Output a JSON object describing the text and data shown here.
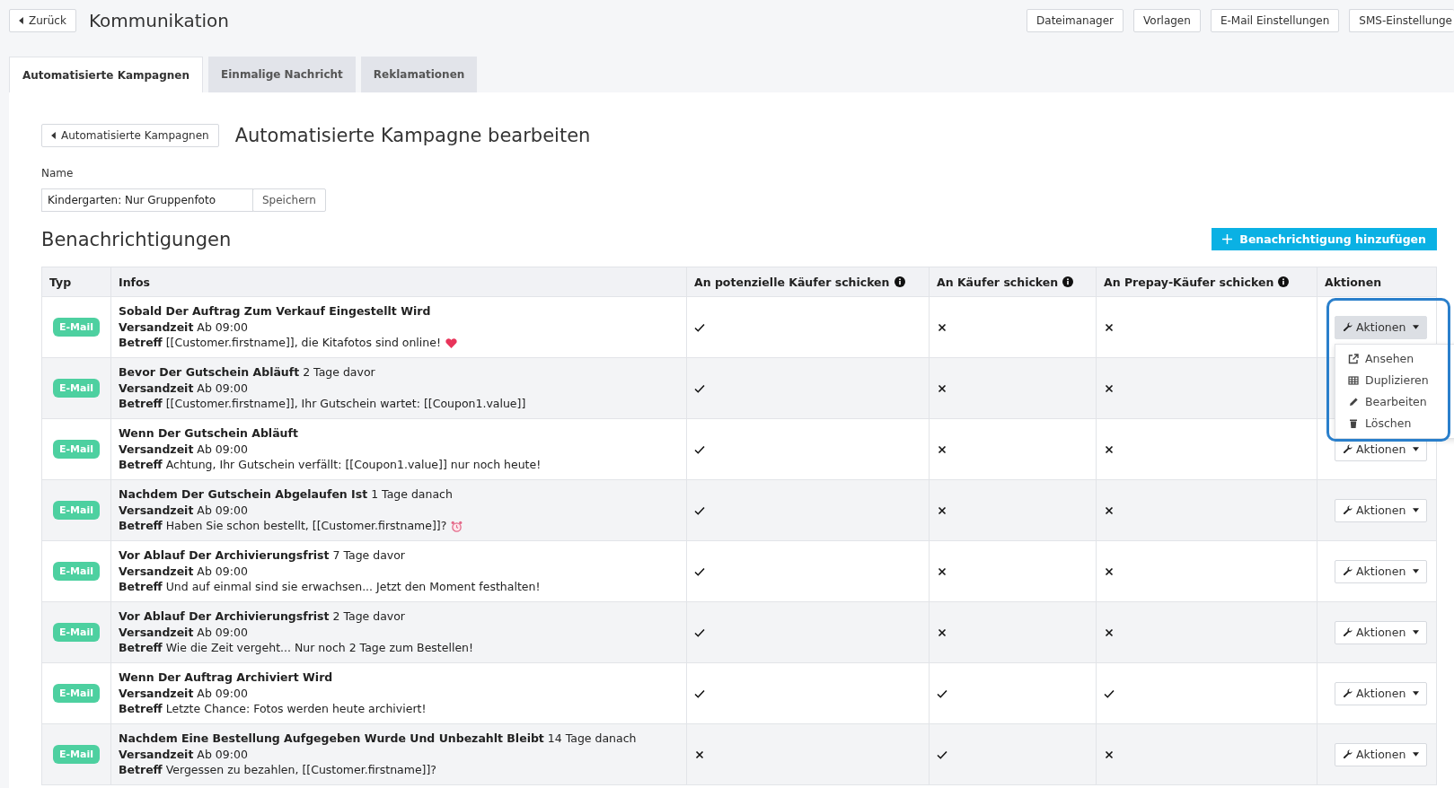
{
  "back_button": "Zurück",
  "title": "Kommunikation",
  "top_buttons": [
    "Dateimanager",
    "Vorlagen",
    "E-Mail Einstellungen",
    "SMS-Einstellunge"
  ],
  "tabs": [
    {
      "label": "Automatisierte Kampagnen",
      "selected": true
    },
    {
      "label": "Einmalige Nachricht",
      "selected": false
    },
    {
      "label": "Reklamationen",
      "selected": false
    }
  ],
  "breadcrumb_button": "Automatisierte Kampagnen",
  "heading": "Automatisierte Kampagne bearbeiten",
  "name_label": "Name",
  "name_value": "Kindergarten: Nur Gruppenfoto",
  "save_button": "Speichern",
  "section_title": "Benachrichtigungen",
  "add_button": "Benachrichtigung hinzufügen",
  "columns": [
    {
      "label": "Typ",
      "info": false
    },
    {
      "label": "Infos",
      "info": false
    },
    {
      "label": "An potenzielle Käufer schicken",
      "info": true
    },
    {
      "label": "An Käufer schicken",
      "info": true
    },
    {
      "label": "An Prepay-Käufer schicken",
      "info": true
    },
    {
      "label": "Aktionen",
      "info": false
    }
  ],
  "rows": [
    {
      "type": "E-Mail",
      "title": "Sobald Der Auftrag Zum Verkauf Eingestellt Wird",
      "title_suffix": "",
      "time_label": "Versandzeit",
      "time": "Ab 09:00",
      "subject_label": "Betreff",
      "subject": "[[Customer.firstname]], die Kitafotos sind online!",
      "potential": true,
      "buyers": false,
      "prepay": false,
      "action": "Aktionen",
      "menu_open": true,
      "highlighted": true,
      "menu": [
        "Ansehen",
        "Duplizieren",
        "Bearbeiten",
        "Löschen"
      ]
    },
    {
      "type": "E-Mail",
      "title": "Bevor Der Gutschein Abläuft",
      "title_suffix": "2 Tage davor",
      "time_label": "Versandzeit",
      "time": "Ab 09:00",
      "subject_label": "Betreff",
      "subject": "[[Customer.firstname]], Ihr Gutschein wartet: [[Coupon1.value]]",
      "potential": true,
      "buyers": false,
      "prepay": false
    },
    {
      "type": "E-Mail",
      "title": "Wenn Der Gutschein Abläuft",
      "title_suffix": "",
      "time_label": "Versandzeit",
      "time": "Ab 09:00",
      "subject_label": "Betreff",
      "subject": "Achtung, Ihr Gutschein verfällt: [[Coupon1.value]] nur noch heute!",
      "potential": true,
      "buyers": false,
      "prepay": false,
      "action": "Aktionen",
      "menu_open": false
    },
    {
      "type": "E-Mail",
      "title": "Nachdem Der Gutschein Abgelaufen Ist",
      "title_suffix": "1 Tage danach",
      "time_label": "Versandzeit",
      "time": "Ab 09:00",
      "subject_label": "Betreff",
      "subject": "Haben Sie schon bestellt, [[Customer.firstname]]?",
      "potential": true,
      "buyers": false,
      "prepay": false,
      "action": "Aktionen",
      "menu_open": false
    },
    {
      "type": "E-Mail",
      "title": "Vor Ablauf Der Archivierungsfrist",
      "title_suffix": "7 Tage davor",
      "time_label": "Versandzeit",
      "time": "Ab 09:00",
      "subject_label": "Betreff",
      "subject": "Und auf einmal sind sie erwachsen... Jetzt den Moment festhalten!",
      "potential": true,
      "buyers": false,
      "prepay": false,
      "action": "Aktionen",
      "menu_open": false
    },
    {
      "type": "E-Mail",
      "title": "Vor Ablauf Der Archivierungsfrist",
      "title_suffix": "2 Tage davor",
      "time_label": "Versandzeit",
      "time": "Ab 09:00",
      "subject_label": "Betreff",
      "subject": "Wie die Zeit vergeht... Nur noch 2 Tage zum Bestellen!",
      "potential": true,
      "buyers": false,
      "prepay": false,
      "action": "Aktionen",
      "menu_open": false
    },
    {
      "type": "E-Mail",
      "title": "Wenn Der Auftrag Archiviert Wird",
      "title_suffix": "",
      "time_label": "Versandzeit",
      "time": "Ab 09:00",
      "subject_label": "Betreff",
      "subject": "Letzte Chance: Fotos werden heute archiviert!",
      "potential": true,
      "buyers": true,
      "prepay": true,
      "action": "Aktionen",
      "menu_open": false
    },
    {
      "type": "E-Mail",
      "title": "Nachdem Eine Bestellung Aufgegeben Wurde Und Unbezahlt Bleibt",
      "title_suffix": "14 Tage danach",
      "time_label": "Versandzeit",
      "time": "Ab 09:00",
      "subject_label": "Betreff",
      "subject": "Vergessen zu bezahlen, [[Customer.firstname]]?",
      "potential": false,
      "buyers": true,
      "prepay": false,
      "action": "Aktionen",
      "menu_open": false
    }
  ]
}
